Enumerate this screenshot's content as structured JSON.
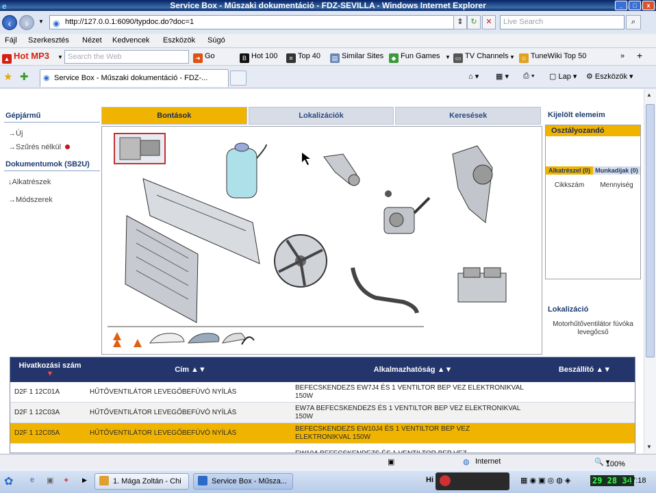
{
  "window": {
    "title": "Service Box - Műszaki dokumentáció - FDZ-SEVILLA - Windows Internet Explorer"
  },
  "address_bar": {
    "url": "http://127.0.0.1:6090/typdoc.do?doc=1",
    "search_placeholder": "Live Search"
  },
  "menu": {
    "items": [
      "Fájl",
      "Szerkesztés",
      "Nézet",
      "Kedvencek",
      "Eszközök",
      "Súgó"
    ]
  },
  "toolbar": {
    "logo": "Hot MP3",
    "search_placeholder": "Search the Web",
    "go_label": "Go",
    "items": [
      "Hot 100",
      "Top 40",
      "Similar Sites",
      "Fun Games",
      "TV Channels",
      "TuneWiki Top 50"
    ]
  },
  "browser_tab": {
    "label": "Service Box - Műszaki dokumentáció - FDZ-...",
    "page_label": "Lap",
    "tools_label": "Eszközök"
  },
  "left_nav": {
    "section1": "Gépjármű",
    "link_new": "Új",
    "link_filter": "Szűrés nélkül",
    "section2": "Dokumentumok (SB2U)",
    "link_parts": "Alkatrészek",
    "link_methods": "Módszerek"
  },
  "main_tabs": [
    "Bontások",
    "Lokalizációk",
    "Keresések"
  ],
  "right_panel": {
    "title": "Kijelölt elemeim",
    "category": "Osztályozandó",
    "col1": "Alkatrészel (0)",
    "col2": "Munkadíjak (0)",
    "sub1": "Cikkszám",
    "sub2": "Mennyiség",
    "lok_title": "Lokalizáció",
    "lok_text": "Motorhűtőventilátor fúvóka levegőcső"
  },
  "table": {
    "headers": [
      "Hivatkozási szám",
      "Cím",
      "Alkalmazhatóság",
      "Beszállító"
    ],
    "rows": [
      {
        "ref": "D2F 1 12C01A",
        "title": "HŰTŐVENTILÁTOR LEVEGŐBEFÚVÓ NYÍLÁS",
        "applicability": "BEFECSKENDEZS EW7J4 ÉS 1 VENTILTOR BEP VEZ ELEKTRONIKVAL 150W",
        "supplier": ""
      },
      {
        "ref": "D2F 1 12C03A",
        "title": "HŰTŐVENTILÁTOR LEVEGŐBEFÚVÓ NYÍLÁS",
        "applicability": "EW7A BEFECSKENDEZS ÉS 1 VENTILTOR BEP VEZ ELEKTRONIKVAL 150W",
        "supplier": ""
      },
      {
        "ref": "D2F 1 12C05A",
        "title": "HŰTŐVENTILÁTOR LEVEGŐBEFÚVÓ NYÍLÁS",
        "applicability": "BEFECSKENDEZS EW10J4 ÉS 1 VENTILTOR BEP VEZ ELEKTRONIKVAL 150W",
        "supplier": ""
      },
      {
        "ref": "",
        "title": "",
        "applicability": "EW10A BEFECSKENDEZS ÉS 1 VENTILTOR BEP VEZ",
        "supplier": ""
      }
    ]
  },
  "status_bar": {
    "zone": "Internet",
    "zoom": "100%"
  },
  "taskbar": {
    "task1": "1. Mága Zoltán - Chi ...",
    "task2": "Service Box - Műsza...",
    "digits": "29 28 34",
    "clock": "17:18"
  },
  "colors": {
    "accent": "#f0b400",
    "table_header": "#23356b",
    "nav_text": "#1a3a6e"
  }
}
